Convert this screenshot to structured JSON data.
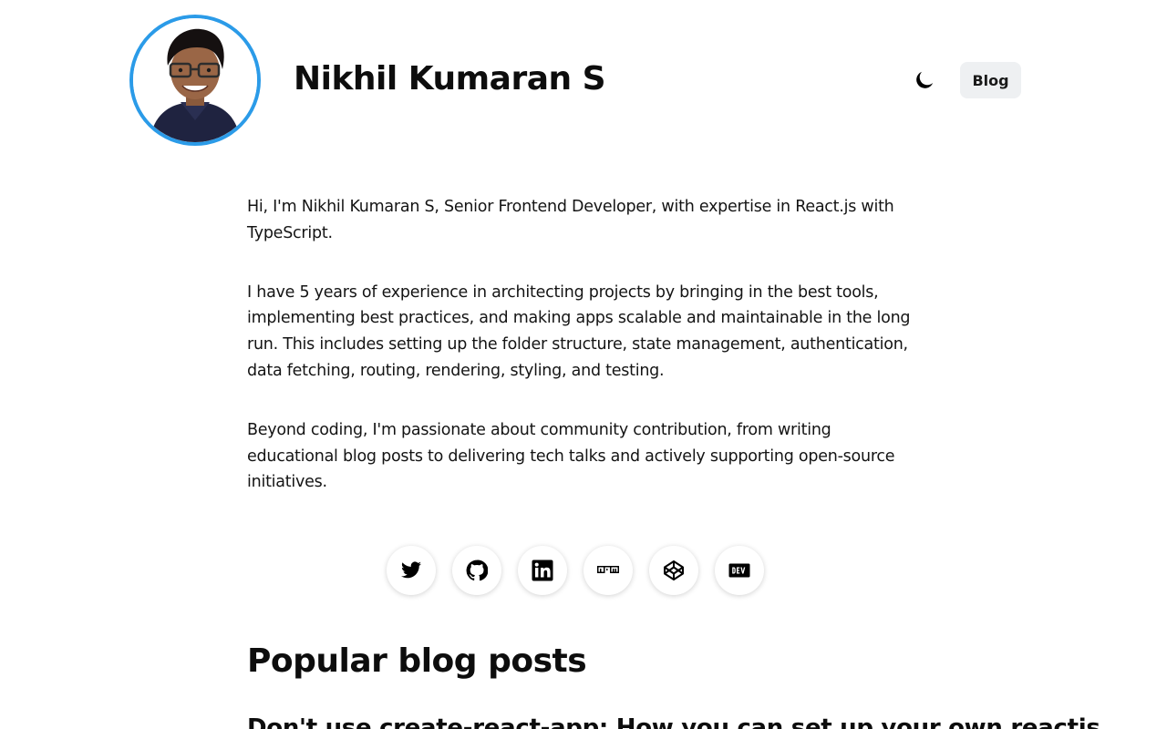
{
  "header": {
    "name": "Nikhil Kumaran S",
    "blog_label": "Blog",
    "theme_toggle_icon": "moon-icon"
  },
  "bio": {
    "paragraphs": [
      "Hi, I'm Nikhil Kumaran S, Senior Frontend Developer, with expertise in React.js with TypeScript.",
      "I have 5 years of experience in architecting projects by bringing in the best tools, implementing best practices, and making apps scalable and maintainable in the long run. This includes setting up the folder structure, state management, authentication, data fetching, routing, rendering, styling, and testing.",
      "Beyond coding, I'm passionate about community contribution, from writing educational blog posts to delivering tech talks and actively supporting open-source initiatives."
    ]
  },
  "socials": [
    {
      "icon": "twitter-icon"
    },
    {
      "icon": "github-icon"
    },
    {
      "icon": "linkedin-icon"
    },
    {
      "icon": "npm-icon"
    },
    {
      "icon": "codepen-icon"
    },
    {
      "icon": "dev-icon"
    }
  ],
  "popular": {
    "title": "Popular blog posts",
    "first_post_title": "Don't use create-react-app: How you can set up your own reactjs"
  },
  "colors": {
    "avatar_ring": "#2b9be8",
    "button_bg": "#eef0f2",
    "text": "#111111"
  }
}
